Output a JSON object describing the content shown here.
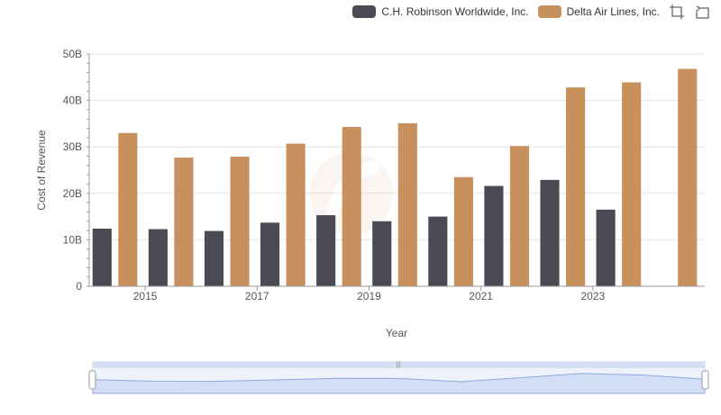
{
  "chart_data": {
    "type": "bar",
    "xlabel": "Year",
    "ylabel": "Cost of Revenue",
    "ylim": [
      0,
      50
    ],
    "y_unit": "B",
    "y_ticks": [
      "0",
      "10B",
      "20B",
      "30B",
      "40B",
      "50B"
    ],
    "grid": true,
    "legend_position": "top-right",
    "x_tick_labels": [
      "2015",
      "2017",
      "2019",
      "2021",
      "2023"
    ],
    "categories": [
      2014,
      2015,
      2016,
      2017,
      2018,
      2019,
      2020,
      2021,
      2022,
      2023,
      2024
    ],
    "series": [
      {
        "name": "C.H. Robinson Worldwide, Inc.",
        "color": "#4a4a55",
        "values": [
          12.4,
          12.3,
          11.9,
          13.7,
          15.3,
          14.0,
          15.0,
          21.6,
          22.9,
          16.5,
          null
        ]
      },
      {
        "name": "Delta Air Lines, Inc.",
        "color": "#c8905c",
        "values": [
          33.0,
          27.7,
          27.9,
          30.7,
          34.3,
          35.1,
          23.5,
          30.2,
          42.8,
          43.9,
          46.8
        ]
      }
    ]
  },
  "legend": {
    "items": [
      {
        "label": "C.H. Robinson Worldwide, Inc.",
        "color": "#4a4a55"
      },
      {
        "label": "Delta Air Lines, Inc.",
        "color": "#c8905c"
      }
    ],
    "tools": [
      "zoom-icon",
      "restore-icon"
    ]
  },
  "zoom": {
    "start_percent": 0,
    "end_percent": 100
  }
}
